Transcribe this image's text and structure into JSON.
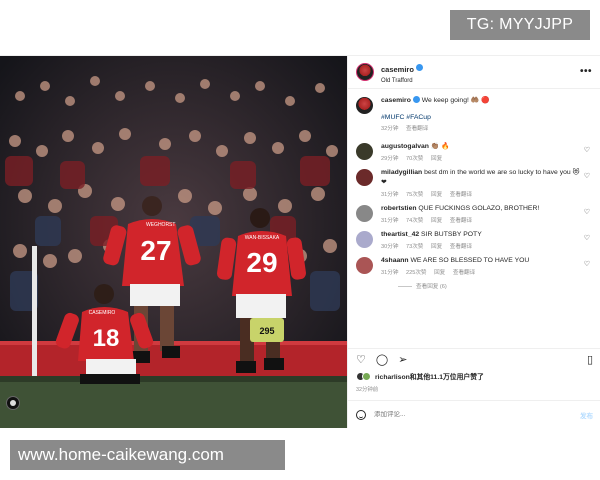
{
  "watermark_top": "TG: MYYJJPP",
  "watermark_bottom": "www.home-caikewang.com",
  "post": {
    "author": "casemiro",
    "location": "Old Trafford",
    "more_icon": "more-horizontal-icon",
    "photo": {
      "shirt_left": "27",
      "shirt_left_name": "WEGHORST",
      "shirt_right": "29",
      "shirt_right_name": "WAN-BISSAKA",
      "shirt_front": "18",
      "shirt_front_name": "CASEMIRO",
      "ad_number": "295"
    },
    "caption": {
      "user": "casemiro",
      "text": "We keep going! 🤲🏽 🔴",
      "tags": "#MUFC #FACup",
      "time": "32分钟",
      "translate": "查看翻译"
    },
    "comments": [
      {
        "user": "augustogalvan",
        "text": "👏🏽 🔥",
        "time": "29分钟",
        "likes": "70次赞",
        "reply": "回复"
      },
      {
        "user": "miladygillian",
        "text": "best dm in the world we are so lucky to have you 😻❤",
        "time": "31分钟",
        "likes": "75次赞",
        "reply": "回复",
        "translate": "查看翻译"
      },
      {
        "user": "robertstien",
        "text": "QUE FUCKINGS GOLAZO, BROTHER!",
        "time": "31分钟",
        "likes": "74次赞",
        "reply": "回复",
        "translate": "查看翻译"
      },
      {
        "user": "theartist_42",
        "text": "SIR BUTSBY POTY",
        "time": "30分钟",
        "likes": "73次赞",
        "reply": "回复",
        "translate": "查看翻译"
      },
      {
        "user": "4shaann",
        "text": "WE ARE SO BLESSED TO HAVE YOU",
        "time": "31分钟",
        "likes": "225次赞",
        "reply": "回复",
        "translate": "查看翻译"
      }
    ],
    "view_replies": "查看回复 (6)",
    "likes": {
      "user": "richarlison",
      "text": "和其他11.1万位用户赞了"
    },
    "date": "32分钟前",
    "comment_placeholder": "添加评论...",
    "post_button": "发布",
    "colors": {
      "verified": "#3897f0",
      "link": "#00376b",
      "united_red": "#d1252b"
    }
  }
}
